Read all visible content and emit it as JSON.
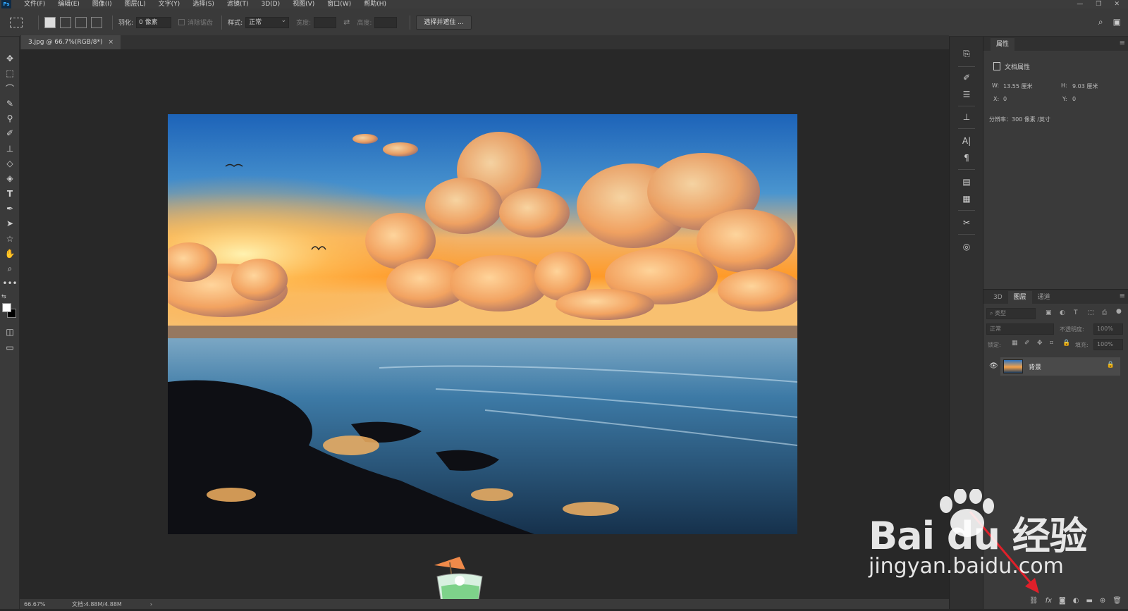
{
  "menubar": {
    "app_icon": "Ps",
    "items": [
      "文件(F)",
      "编辑(E)",
      "图像(I)",
      "图层(L)",
      "文字(Y)",
      "选择(S)",
      "滤镜(T)",
      "3D(D)",
      "视图(V)",
      "窗口(W)",
      "帮助(H)"
    ]
  },
  "optionsbar": {
    "feather_label": "羽化:",
    "feather_value": "0 像素",
    "antialias_label": "消除锯齿",
    "style_label": "样式:",
    "style_value": "正常",
    "width_label": "宽度:",
    "height_label": "高度:",
    "select_mask_button": "选择并遮住 ..."
  },
  "document": {
    "tab_title": "3.jpg @ 66.7%(RGB/8*)",
    "close_glyph": "×"
  },
  "statusbar": {
    "zoom": "66.67%",
    "doc_size": "文档:4.88M/4.88M",
    "arrow": "›"
  },
  "properties": {
    "tab": "属性",
    "section": "文档属性",
    "w_label": "W:",
    "w_value": "13.55 厘米",
    "h_label": "H:",
    "h_value": "9.03 厘米",
    "x_label": "X:",
    "x_value": "0",
    "y_label": "Y:",
    "y_value": "0",
    "resolution": "分辨率：300 像素 /英寸"
  },
  "layers": {
    "tabs": [
      "3D",
      "图层",
      "通道"
    ],
    "active_tab": "图层",
    "filter_placeholder": "类型",
    "blend_mode": "正常",
    "opacity_label": "不透明度:",
    "opacity_value": "100%",
    "lock_label": "锁定:",
    "fill_label": "填充:",
    "fill_value": "100%",
    "layer_name": "背景"
  },
  "watermark": {
    "brand": "Bai du 经验",
    "url": "jingyan.baidu.com"
  },
  "icons": {
    "toolbar": [
      "move-icon",
      "marquee-icon",
      "lasso-icon",
      "quick-select-icon",
      "eyedropper-icon",
      "brush-icon",
      "stamp-icon",
      "eraser-icon",
      "paint-bucket-icon",
      "type-icon",
      "pen-icon",
      "path-select-icon",
      "shape-icon",
      "hand-icon",
      "zoom-icon",
      "more-icon"
    ]
  }
}
